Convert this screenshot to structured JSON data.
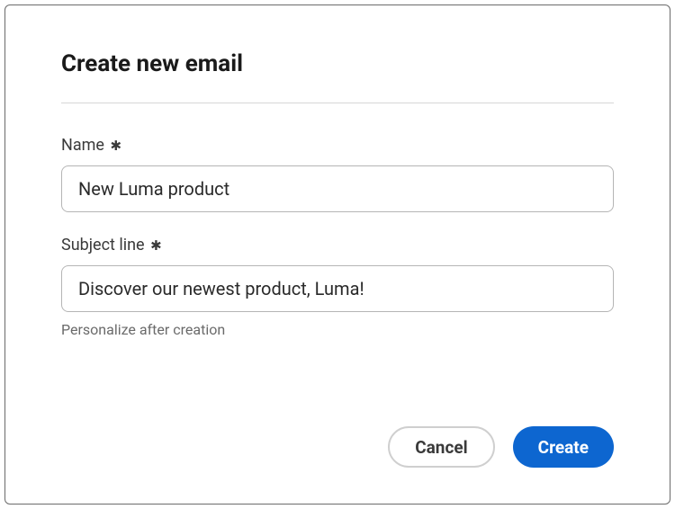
{
  "dialog": {
    "title": "Create new email",
    "fields": {
      "name": {
        "label": "Name",
        "required_mark": "✱",
        "value": "New Luma product"
      },
      "subject": {
        "label": "Subject line",
        "required_mark": "✱",
        "value": "Discover our newest product, Luma!",
        "help": "Personalize after creation"
      }
    },
    "buttons": {
      "cancel": "Cancel",
      "create": "Create"
    }
  }
}
